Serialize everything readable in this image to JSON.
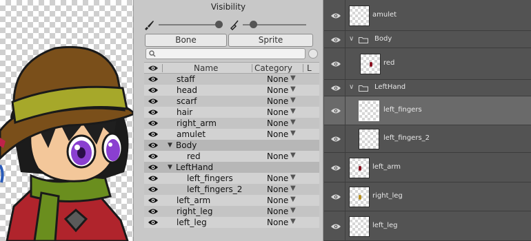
{
  "visibility_panel": {
    "title": "Visibility",
    "toggle_bone": "Bone",
    "toggle_sprite": "Sprite",
    "search_placeholder": "",
    "columns": {
      "name": "Name",
      "category": "Category",
      "extra": "L"
    },
    "rows": [
      {
        "name": "staff",
        "category": "None"
      },
      {
        "name": "head",
        "category": "None"
      },
      {
        "name": "scarf",
        "category": "None"
      },
      {
        "name": "hair",
        "category": "None"
      },
      {
        "name": "right_arm",
        "category": "None"
      },
      {
        "name": "amulet",
        "category": "None"
      },
      {
        "name": "Body",
        "category": ""
      },
      {
        "name": "red",
        "category": "None"
      },
      {
        "name": "LeftHand",
        "category": ""
      },
      {
        "name": "left_fingers",
        "category": "None"
      },
      {
        "name": "left_fingers_2",
        "category": "None"
      },
      {
        "name": "left_arm",
        "category": "None"
      },
      {
        "name": "right_leg",
        "category": "None"
      },
      {
        "name": "left_leg",
        "category": "None"
      }
    ]
  },
  "layers_panel": {
    "layers": [
      {
        "name": "amulet"
      },
      {
        "name": "Body"
      },
      {
        "name": "red"
      },
      {
        "name": "LeftHand"
      },
      {
        "name": "left_fingers"
      },
      {
        "name": "left_fingers_2"
      },
      {
        "name": "left_arm"
      },
      {
        "name": "right_leg"
      },
      {
        "name": "left_leg"
      }
    ]
  },
  "colors": {
    "panel_bg": "#c8c8c8",
    "layers_bg": "#535353",
    "selected_layer": "#6a6a6a"
  }
}
